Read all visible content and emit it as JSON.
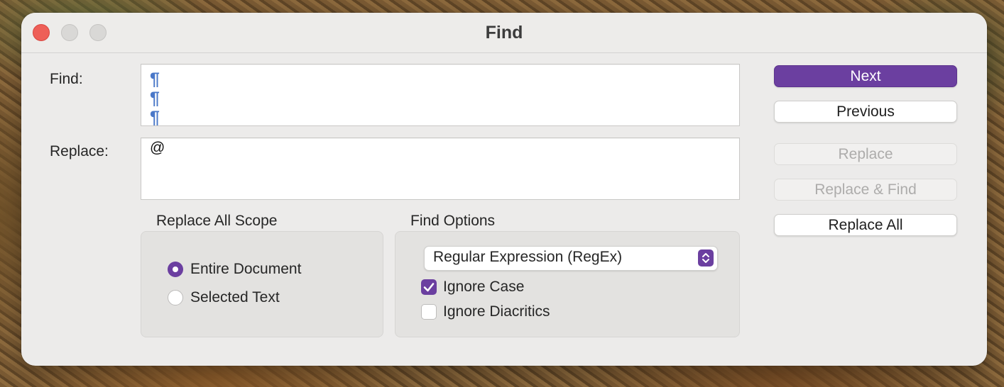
{
  "window": {
    "title": "Find"
  },
  "find": {
    "label": "Find:",
    "value_lines": [
      "¶",
      "¶",
      "¶"
    ]
  },
  "replace": {
    "label": "Replace:",
    "value": "@"
  },
  "scope": {
    "title": "Replace All Scope",
    "options": [
      {
        "label": "Entire Document",
        "selected": true
      },
      {
        "label": "Selected Text",
        "selected": false
      }
    ]
  },
  "find_options": {
    "title": "Find Options",
    "mode": "Regular Expression (RegEx)",
    "ignore_case": {
      "label": "Ignore Case",
      "checked": true
    },
    "ignore_diacritics": {
      "label": "Ignore Diacritics",
      "checked": false
    }
  },
  "buttons": {
    "next": "Next",
    "previous": "Previous",
    "replace": "Replace",
    "replace_find": "Replace & Find",
    "replace_all": "Replace All"
  },
  "colors": {
    "accent": "#6b3fa0",
    "close": "#ee5f57",
    "pilcrow": "#4a78c8"
  }
}
